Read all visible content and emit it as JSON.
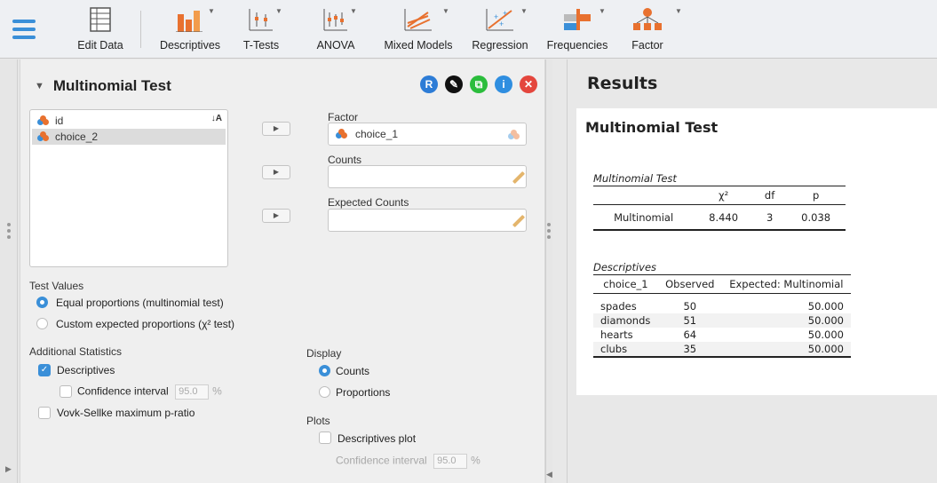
{
  "toolbar": {
    "items": [
      {
        "label": "Edit Data",
        "icon": "spreadsheet-icon"
      },
      {
        "label": "Descriptives",
        "icon": "bar-chart-icon"
      },
      {
        "label": "T-Tests",
        "icon": "t-test-icon"
      },
      {
        "label": "ANOVA",
        "icon": "anova-icon"
      },
      {
        "label": "Mixed Models",
        "icon": "mixed-models-icon"
      },
      {
        "label": "Regression",
        "icon": "regression-icon"
      },
      {
        "label": "Frequencies",
        "icon": "frequencies-icon"
      },
      {
        "label": "Factor",
        "icon": "factor-icon"
      }
    ]
  },
  "analysis": {
    "title": "Multinomial Test",
    "header_icons": [
      {
        "name": "r-syntax-icon",
        "glyph": "R",
        "color": "#2d7cd6"
      },
      {
        "name": "edit-icon",
        "glyph": "✎",
        "color": "#111111"
      },
      {
        "name": "duplicate-icon",
        "glyph": "⧉",
        "color": "#2bbd3c"
      },
      {
        "name": "info-icon",
        "glyph": "i",
        "color": "#2f8ee0"
      },
      {
        "name": "close-icon",
        "glyph": "✕",
        "color": "#e4463d"
      }
    ],
    "variables": [
      "id",
      "choice_2"
    ],
    "factor_label": "Factor",
    "factor_value": "choice_1",
    "counts_label": "Counts",
    "counts_value": "",
    "expected_label": "Expected Counts",
    "expected_value": "",
    "arrow_glyph": "▶",
    "test_values": {
      "heading": "Test Values",
      "options": [
        {
          "label": "Equal proportions (multinomial test)",
          "selected": true
        },
        {
          "label": "Custom expected proportions (χ² test)",
          "selected": false
        }
      ]
    },
    "additional": {
      "heading": "Additional Statistics",
      "descriptives_label": "Descriptives",
      "descriptives_checked": true,
      "ci_label": "Confidence interval",
      "ci_value": "95.0",
      "ci_unit": "%",
      "vs_label": "Vovk-Sellke maximum p-ratio"
    },
    "display": {
      "heading": "Display",
      "options": [
        {
          "label": "Counts",
          "selected": true
        },
        {
          "label": "Proportions",
          "selected": false
        }
      ]
    },
    "plots": {
      "heading": "Plots",
      "descriptives_plot_label": "Descriptives plot",
      "ci_label": "Confidence interval",
      "ci_value": "95.0",
      "ci_unit": "%"
    }
  },
  "results": {
    "heading": "Results",
    "subheading": "Multinomial Test",
    "table1": {
      "caption": "Multinomial Test",
      "headers": [
        "",
        "χ²",
        "df",
        "p"
      ],
      "rows": [
        [
          "Multinomial",
          "8.440",
          "3",
          "0.038"
        ]
      ]
    },
    "table2": {
      "caption": "Descriptives",
      "headers": [
        "choice_1",
        "Observed",
        "Expected: Multinomial"
      ],
      "rows": [
        [
          "spades",
          "50",
          "50.000"
        ],
        [
          "diamonds",
          "51",
          "50.000"
        ],
        [
          "hearts",
          "64",
          "50.000"
        ],
        [
          "clubs",
          "35",
          "50.000"
        ]
      ]
    }
  }
}
